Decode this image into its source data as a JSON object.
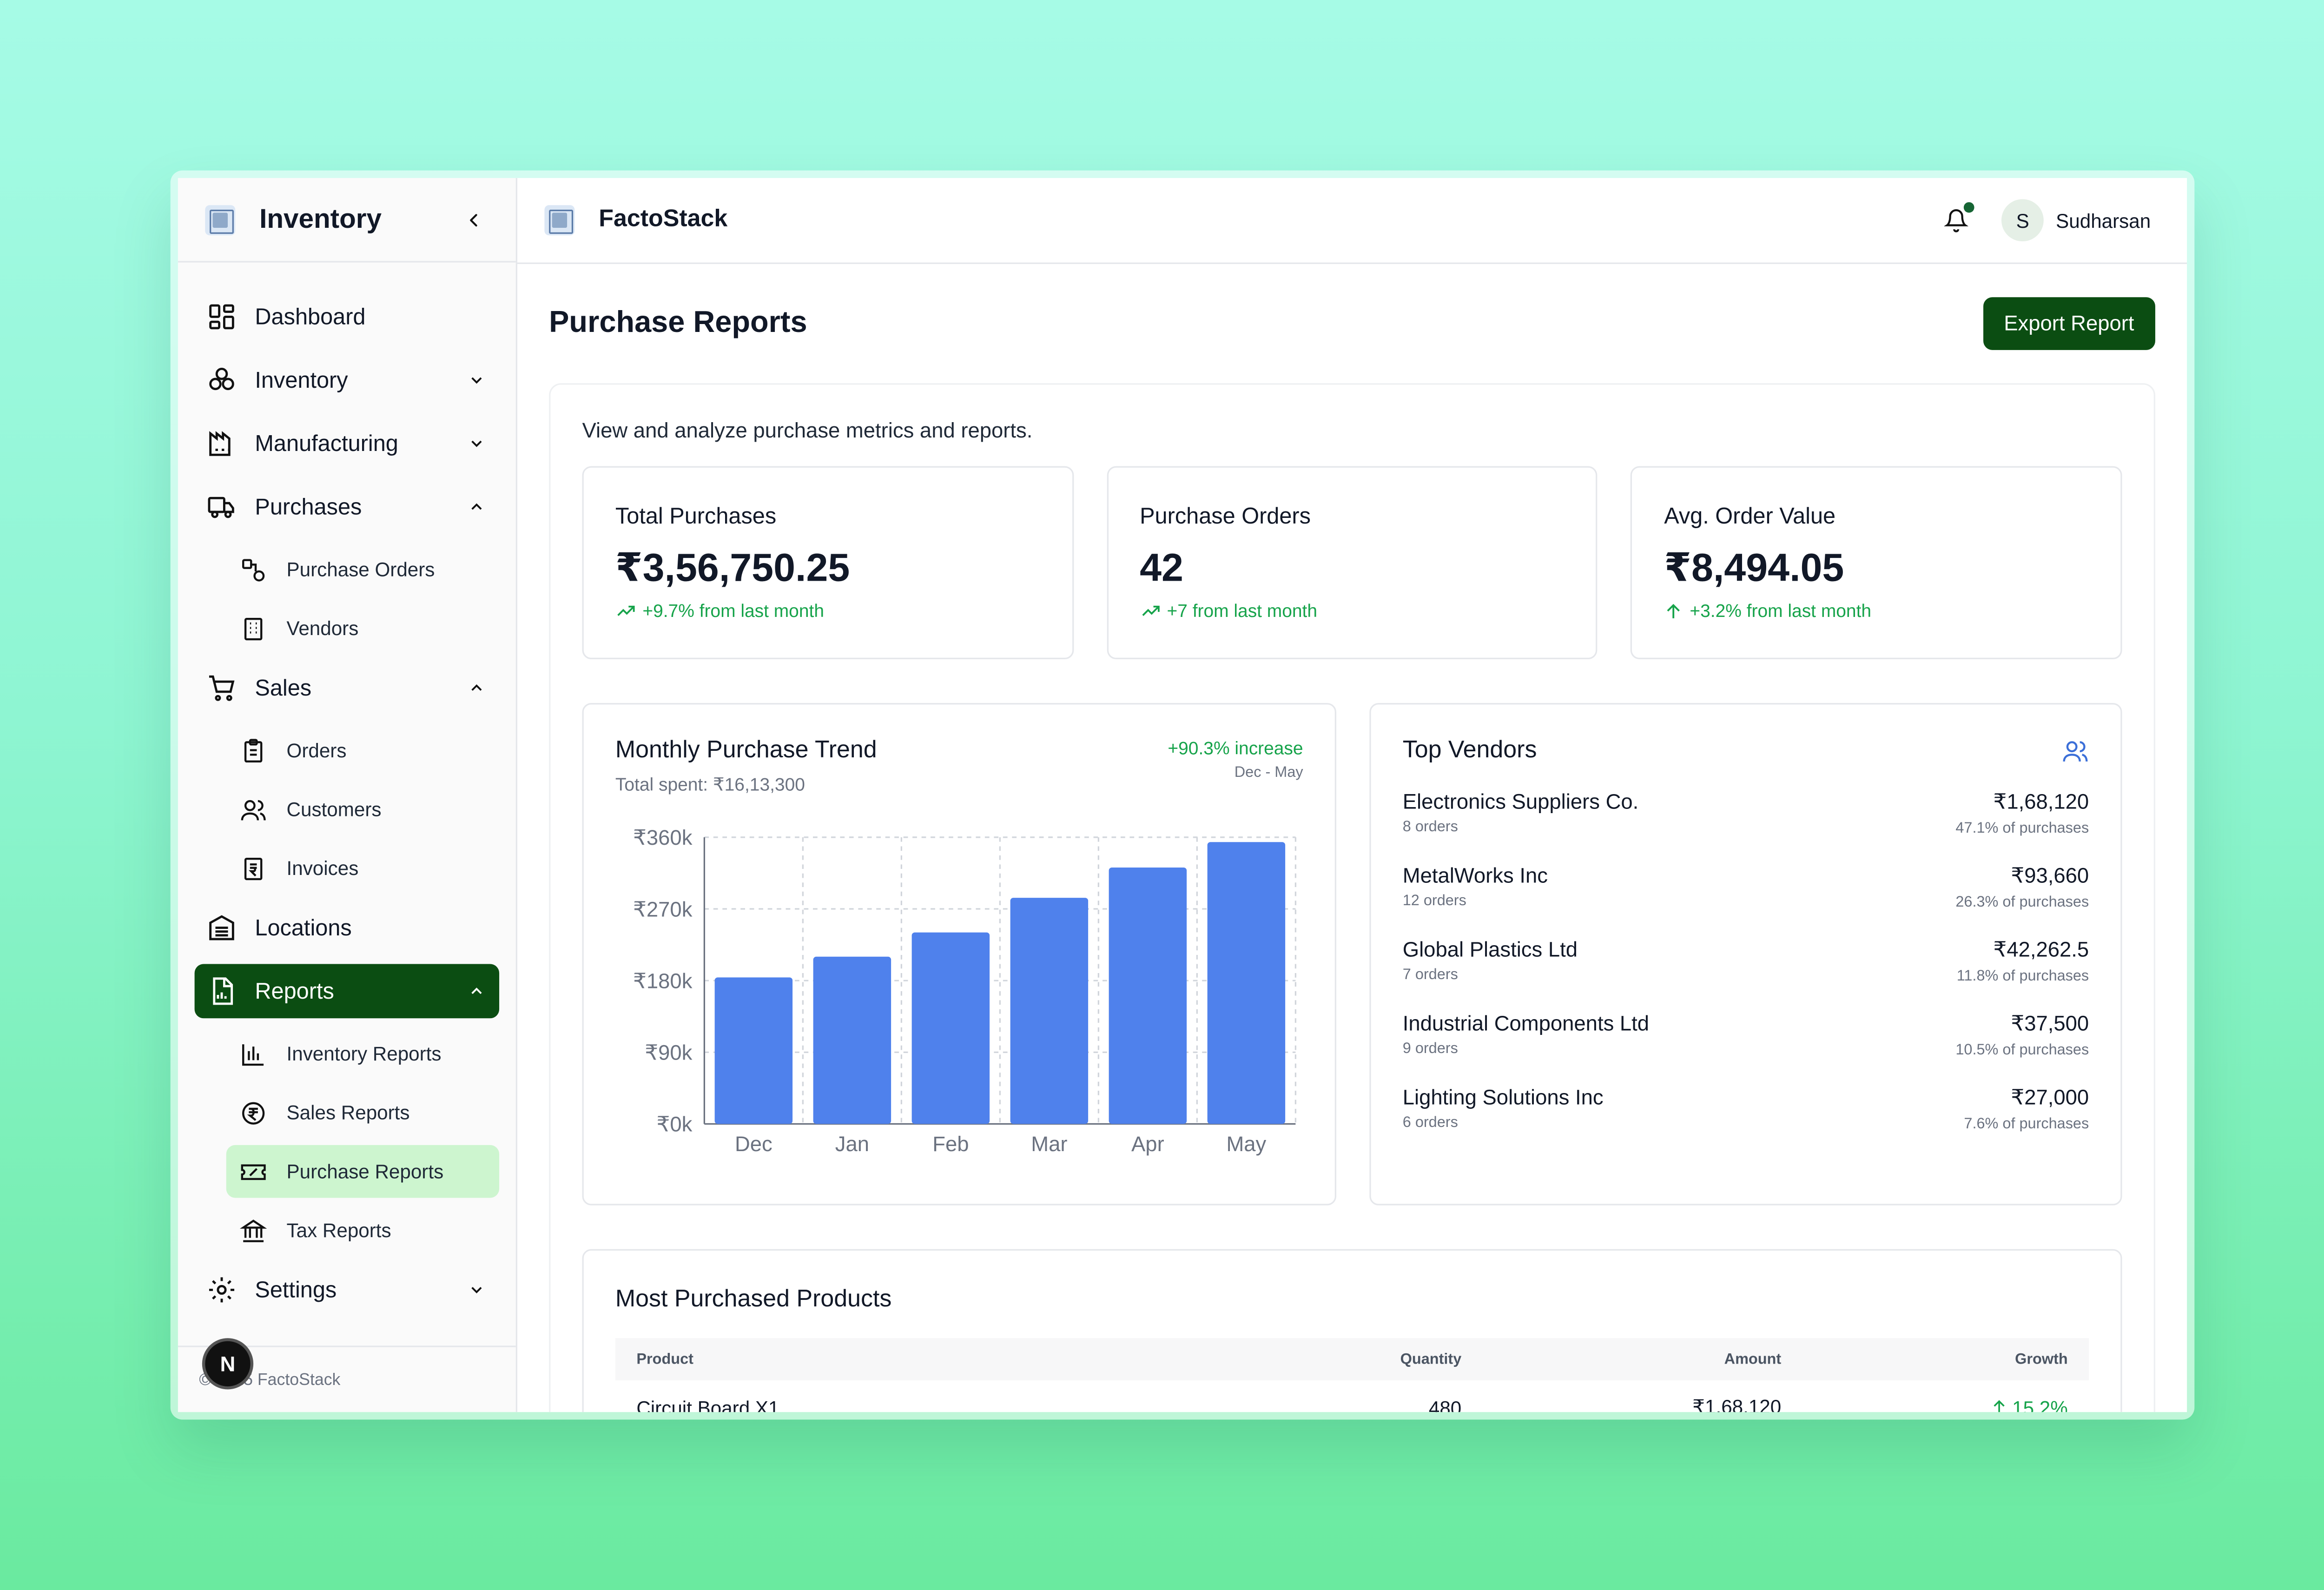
{
  "sidebar": {
    "title": "Inventory",
    "footer": "© 2025 FactoStack",
    "footer_badge": "N",
    "items": [
      {
        "label": "Dashboard",
        "icon": "dashboard-icon"
      },
      {
        "label": "Inventory",
        "icon": "boxes-icon"
      },
      {
        "label": "Manufacturing",
        "icon": "factory-icon"
      },
      {
        "label": "Purchases",
        "icon": "truck-icon"
      },
      {
        "label": "Sales",
        "icon": "cart-icon"
      },
      {
        "label": "Locations",
        "icon": "warehouse-icon"
      },
      {
        "label": "Reports",
        "icon": "report-icon"
      },
      {
        "label": "Settings",
        "icon": "gear-icon"
      }
    ],
    "purchases_sub": [
      {
        "label": "Purchase Orders",
        "icon": "shapes-icon"
      },
      {
        "label": "Vendors",
        "icon": "building-icon"
      }
    ],
    "sales_sub": [
      {
        "label": "Orders",
        "icon": "clipboard-icon"
      },
      {
        "label": "Customers",
        "icon": "users-icon"
      },
      {
        "label": "Invoices",
        "icon": "invoice-icon"
      }
    ],
    "reports_sub": [
      {
        "label": "Inventory Reports",
        "icon": "bar-chart-icon"
      },
      {
        "label": "Sales Reports",
        "icon": "rupee-circle-icon"
      },
      {
        "label": "Purchase Reports",
        "icon": "ticket-icon"
      },
      {
        "label": "Tax Reports",
        "icon": "bank-icon"
      }
    ]
  },
  "topbar": {
    "brand": "FactoStack",
    "user_initial": "S",
    "user_name": "Sudharsan"
  },
  "page": {
    "title": "Purchase Reports",
    "export_label": "Export Report",
    "description": "View and analyze purchase metrics and reports."
  },
  "kpis": [
    {
      "label": "Total Purchases",
      "value": "₹3,56,750.25",
      "delta": "+9.7% from last month"
    },
    {
      "label": "Purchase Orders",
      "value": "42",
      "delta": "+7 from last month"
    },
    {
      "label": "Avg. Order Value",
      "value": "₹8,494.05",
      "delta": "+3.2% from last month"
    }
  ],
  "trend": {
    "title": "Monthly Purchase Trend",
    "subtitle": "Total spent: ₹16,13,300",
    "increase": "+90.3% increase",
    "range": "Dec - May"
  },
  "chart_data": {
    "type": "bar",
    "title": "Monthly Purchase Trend",
    "categories": [
      "Dec",
      "Jan",
      "Feb",
      "Mar",
      "Apr",
      "May"
    ],
    "values": [
      184000,
      210000,
      240500,
      284000,
      322000,
      354000
    ],
    "yticks": [
      "₹0k",
      "₹90k",
      "₹180k",
      "₹270k",
      "₹360k"
    ],
    "ylim": [
      0,
      360000
    ],
    "grid": true,
    "color": "#4f81ec"
  },
  "vendors": {
    "title": "Top Vendors",
    "rows": [
      {
        "name": "Electronics Suppliers Co.",
        "orders": "8 orders",
        "amount": "₹1,68,120",
        "share": "47.1% of purchases"
      },
      {
        "name": "MetalWorks Inc",
        "orders": "12 orders",
        "amount": "₹93,660",
        "share": "26.3% of purchases"
      },
      {
        "name": "Global Plastics Ltd",
        "orders": "7 orders",
        "amount": "₹42,262.5",
        "share": "11.8% of purchases"
      },
      {
        "name": "Industrial Components Ltd",
        "orders": "9 orders",
        "amount": "₹37,500",
        "share": "10.5% of purchases"
      },
      {
        "name": "Lighting Solutions Inc",
        "orders": "6 orders",
        "amount": "₹27,000",
        "share": "7.6% of purchases"
      }
    ]
  },
  "products": {
    "title": "Most Purchased Products",
    "headers": {
      "product": "Product",
      "quantity": "Quantity",
      "amount": "Amount",
      "growth": "Growth"
    },
    "rows": [
      {
        "product": "Circuit Board X1",
        "quantity": "480",
        "amount": "₹1,68,120",
        "growth": "15.2%"
      }
    ]
  },
  "colors": {
    "accent": "#0b4d12",
    "positive": "#16a34a",
    "bar": "#4f81ec",
    "active_sub": "#cdf5cf"
  }
}
